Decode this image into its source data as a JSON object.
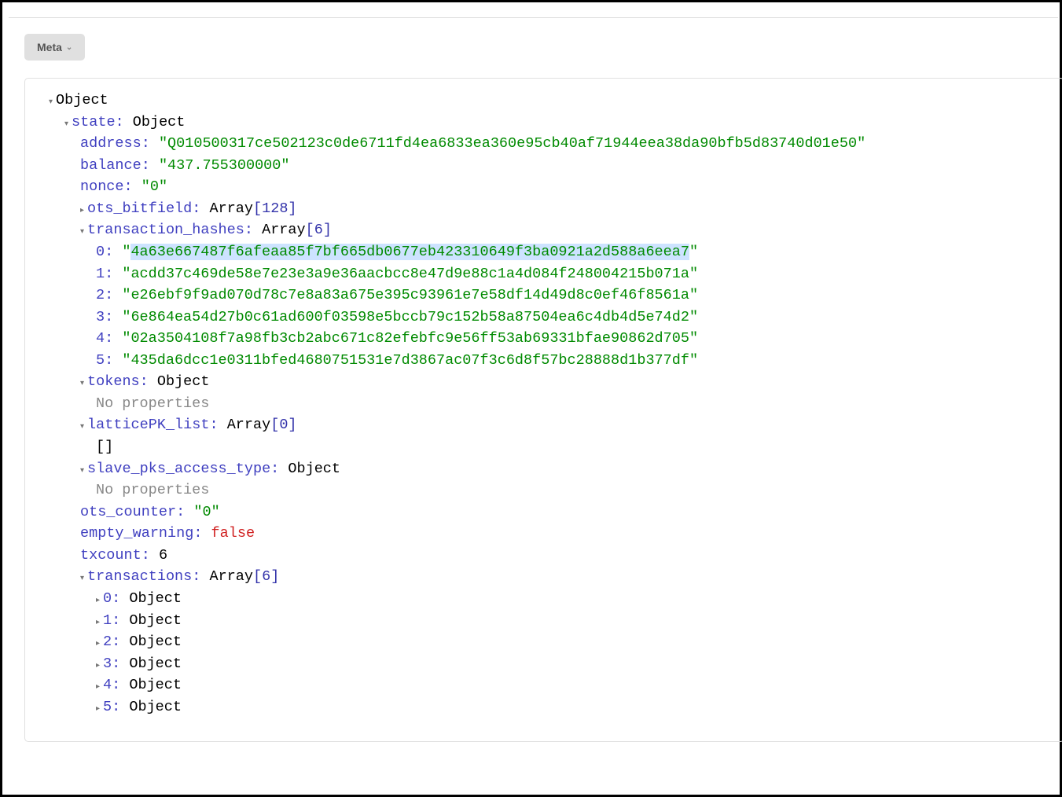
{
  "meta_button": "Meta",
  "tree": {
    "root_type": "Object",
    "state": {
      "key": "state",
      "type": "Object",
      "address_key": "address",
      "address_val": "Q010500317ce502123c0de6711fd4ea6833ea360e95cb40af71944eea38da90bfb5d83740d01e50",
      "balance_key": "balance",
      "balance_val": "437.755300000",
      "nonce_key": "nonce",
      "nonce_val": "0",
      "ots_bitfield_key": "ots_bitfield",
      "ots_bitfield_type": "Array",
      "ots_bitfield_len": "128",
      "tx_hashes_key": "transaction_hashes",
      "tx_hashes_type": "Array",
      "tx_hashes_len": "6",
      "tx_hashes": [
        "4a63e667487f6afeaa85f7bf665db0677eb423310649f3ba0921a2d588a6eea7",
        "acdd37c469de58e7e23e3a9e36aacbcc8e47d9e88c1a4d084f248004215b071a",
        "e26ebf9f9ad070d78c7e8a83a675e395c93961e7e58df14d49d8c0ef46f8561a",
        "6e864ea54d27b0c61ad600f03598e5bccb79c152b58a87504ea6c4db4d5e74d2",
        "02a3504108f7a98fb3cb2abc671c82efebfc9e56ff53ab69331bfae90862d705",
        "435da6dcc1e0311bfed4680751531e7d3867ac07f3c6d8f57bc28888d1b377df"
      ],
      "tokens_key": "tokens",
      "tokens_type": "Object",
      "no_properties": "No properties",
      "latticepk_key": "latticePK_list",
      "latticepk_type": "Array",
      "latticepk_len": "0",
      "empty_array": "[]",
      "slave_key": "slave_pks_access_type",
      "slave_type": "Object",
      "ots_counter_key": "ots_counter",
      "ots_counter_val": "0",
      "empty_warning_key": "empty_warning",
      "empty_warning_val": "false",
      "txcount_key": "txcount",
      "txcount_val": "6",
      "transactions_key": "transactions",
      "transactions_type": "Array",
      "transactions_len": "6",
      "transactions": [
        "0",
        "1",
        "2",
        "3",
        "4",
        "5"
      ],
      "obj_type": "Object"
    }
  }
}
